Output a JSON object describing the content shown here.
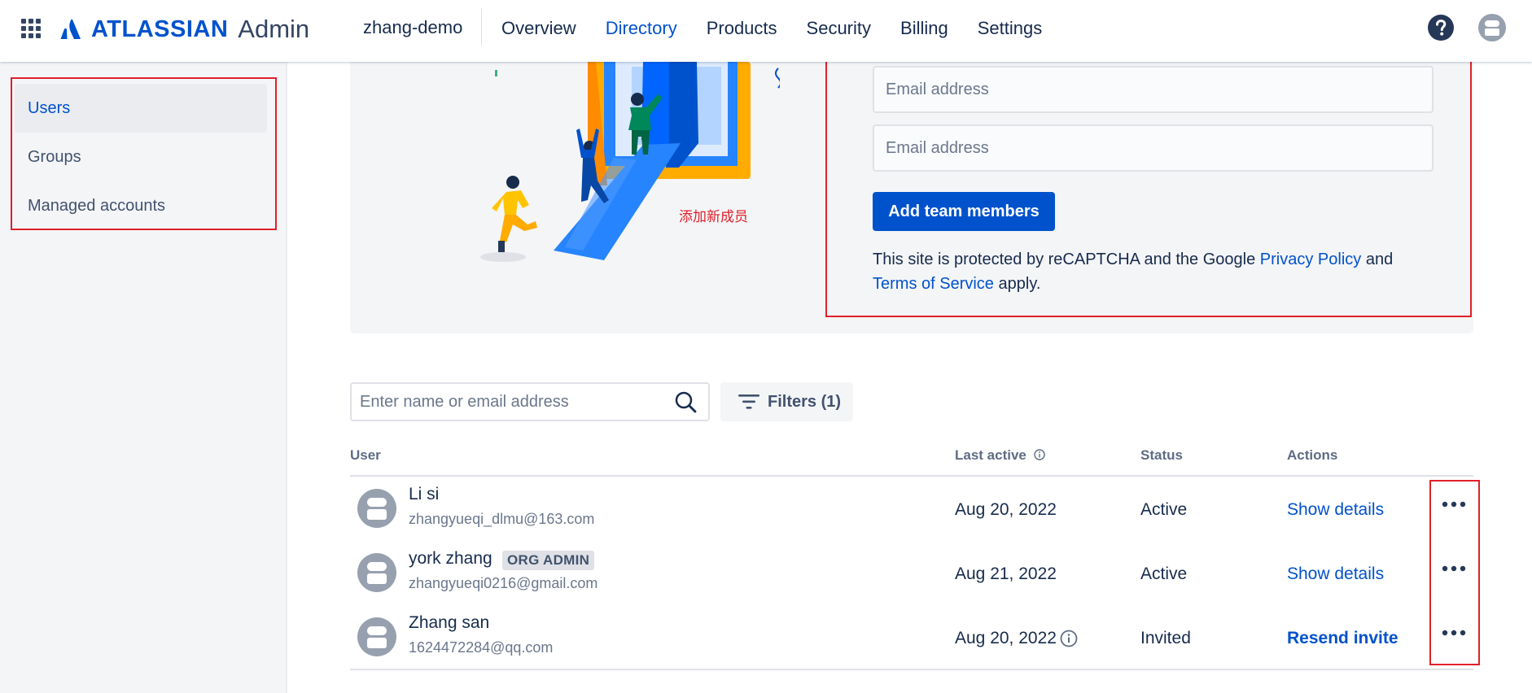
{
  "topnav": {
    "brand_name": "ATLASSIAN",
    "brand_product": "Admin",
    "org_name": "zhang-demo",
    "items": [
      {
        "label": "Overview",
        "active": false
      },
      {
        "label": "Directory",
        "active": true
      },
      {
        "label": "Products",
        "active": false
      },
      {
        "label": "Security",
        "active": false
      },
      {
        "label": "Billing",
        "active": false
      },
      {
        "label": "Settings",
        "active": false
      }
    ]
  },
  "sidebar": {
    "items": [
      {
        "label": "Users",
        "active": true
      },
      {
        "label": "Groups",
        "active": false
      },
      {
        "label": "Managed accounts",
        "active": false
      }
    ]
  },
  "invite": {
    "annotation": "添加新成员",
    "email_placeholder": "Email address",
    "add_button_label": "Add team members",
    "captcha_text_1": "This site is protected by reCAPTCHA and the Google",
    "privacy_link": "Privacy Policy",
    "captcha_and": "and",
    "terms_link": "Terms of Service",
    "captcha_text_2": "apply."
  },
  "search": {
    "placeholder": "Enter name or email address",
    "filter_label": "Filters (1)"
  },
  "table": {
    "headers": {
      "user": "User",
      "last_active": "Last active",
      "status": "Status",
      "actions": "Actions"
    },
    "rows": [
      {
        "name": "Li si",
        "email": "zhangyueqi_dlmu@163.com",
        "badge": "",
        "last_active": "Aug 20, 2022",
        "status": "Active",
        "action": "Show details"
      },
      {
        "name": "york zhang",
        "email": "zhangyueqi0216@gmail.com",
        "badge": "ORG ADMIN",
        "last_active": "Aug 21, 2022",
        "status": "Active",
        "action": "Show details"
      },
      {
        "name": "Zhang san",
        "email": "1624472284@qq.com",
        "badge": "",
        "last_active": "Aug 20, 2022",
        "status": "Invited",
        "action": "Resend invite"
      }
    ]
  },
  "colors": {
    "brand_blue": "#0052cc",
    "annotation_red": "#e0202a",
    "text_dark": "#172b4d",
    "sidebar_bg": "#f4f5f7"
  },
  "icons": [
    "app-switcher-icon",
    "atlassian-logo-icon",
    "help-icon",
    "profile-icon",
    "search-icon",
    "filter-icon",
    "info-icon",
    "more-actions-icon",
    "user-avatar-icon"
  ]
}
